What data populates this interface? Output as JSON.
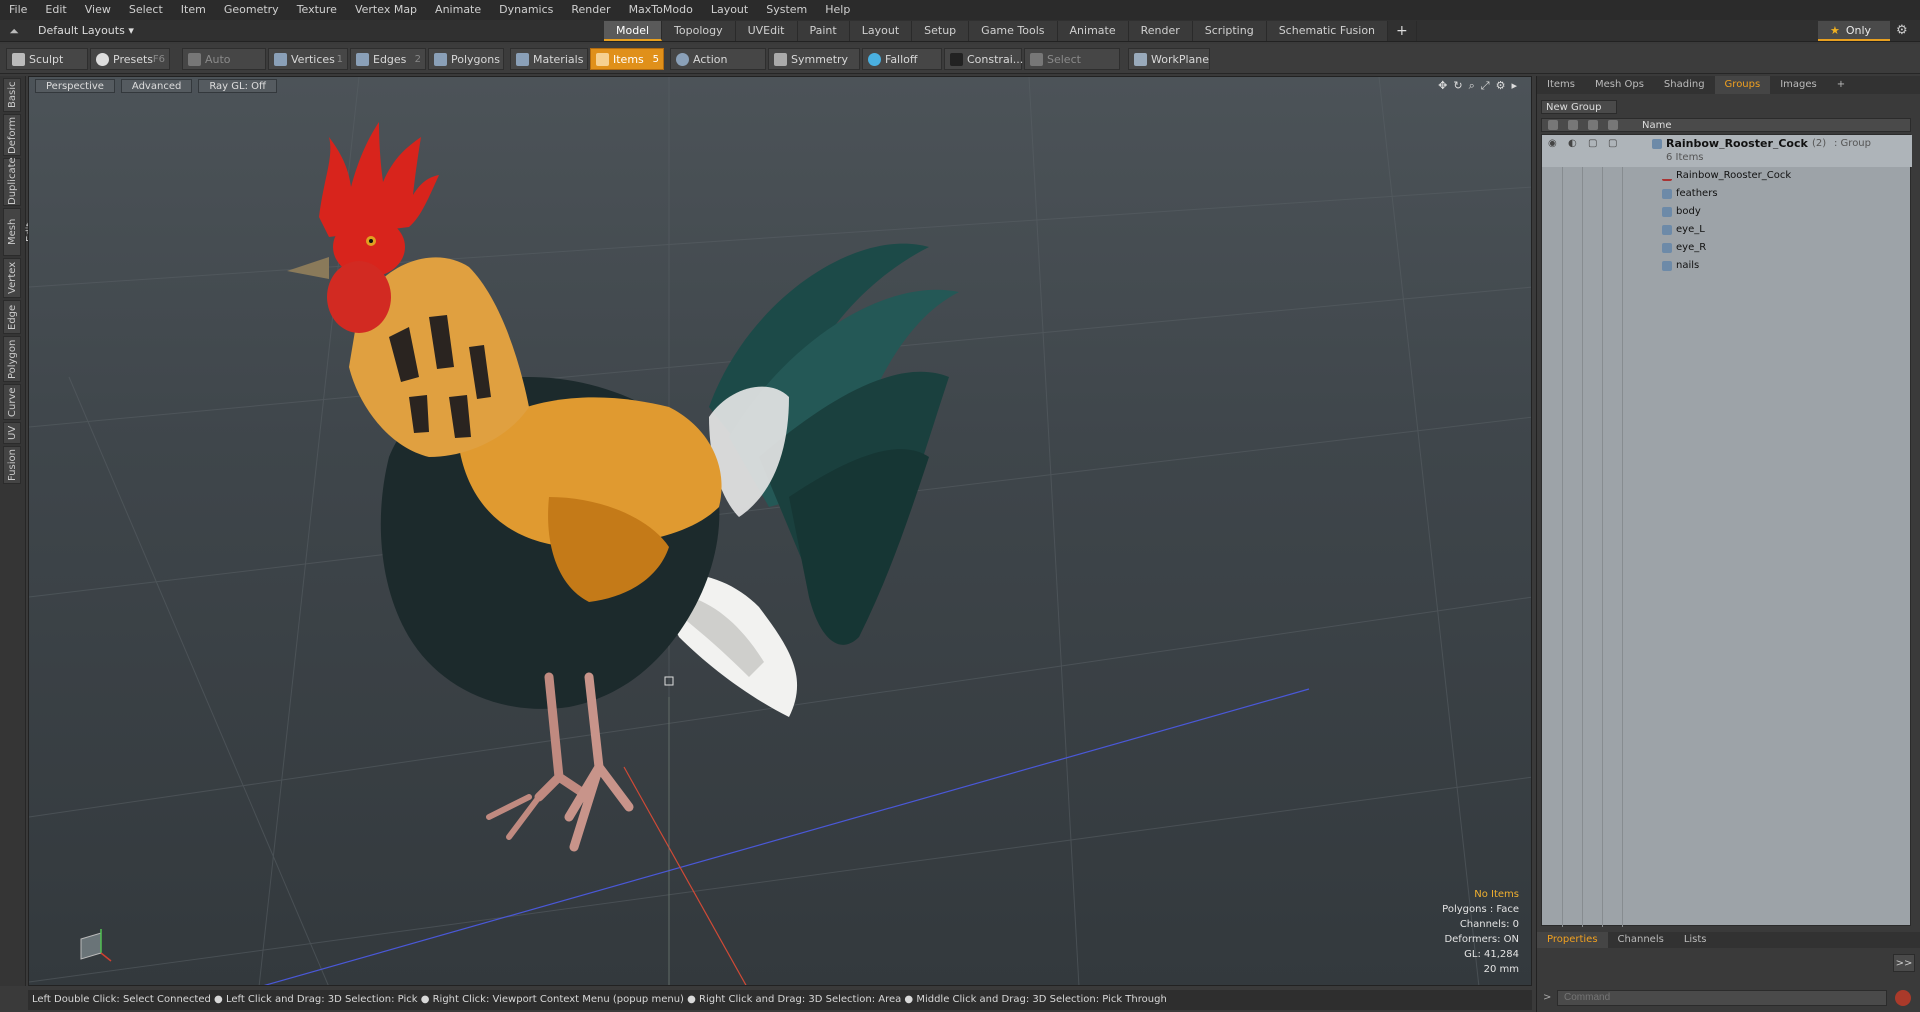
{
  "menu": [
    "File",
    "Edit",
    "View",
    "Select",
    "Item",
    "Geometry",
    "Texture",
    "Vertex Map",
    "Animate",
    "Dynamics",
    "Render",
    "MaxToModo",
    "Layout",
    "System",
    "Help"
  ],
  "layout_label": "Default Layouts",
  "tabs": [
    "Model",
    "Topology",
    "UVEdit",
    "Paint",
    "Layout",
    "Setup",
    "Game Tools",
    "Animate",
    "Render",
    "Scripting",
    "Schematic Fusion"
  ],
  "active_tab": "Model",
  "only_label": "Only",
  "toolbar": {
    "sculpt": "Sculpt",
    "presets": "Presets",
    "presets_key": "F6",
    "auto_select": "Auto Select",
    "vertices": "Vertices",
    "vertices_count": "1",
    "edges": "Edges",
    "edges_count": "2",
    "polygons": "Polygons",
    "materials": "Materials",
    "items": "Items",
    "items_count": "5",
    "action_center": "Action Center",
    "symmetry": "Symmetry",
    "falloff": "Falloff",
    "constrain": "Constrai...",
    "select_through": "Select Through",
    "workplane": "WorkPlane"
  },
  "left_tabs": [
    "Basic",
    "Deform",
    "Duplicate",
    "Mesh Edit",
    "Vertex",
    "Edge",
    "Polygon",
    "Curve",
    "UV",
    "Fusion"
  ],
  "viewport": {
    "perspective": "Perspective",
    "advanced": "Advanced",
    "raygl": "Ray GL: Off",
    "info": {
      "items": "No Items",
      "polygons": "Polygons : Face",
      "channels": "Channels: 0",
      "deformers": "Deformers: ON",
      "gl": "GL: 41,284",
      "size": "20 mm"
    }
  },
  "status_text": "Left Double Click: Select Connected ● Left Click and Drag: 3D Selection: Pick ● Right Click: Viewport Context Menu (popup menu) ● Right Click and Drag: 3D Selection: Area ● Middle Click and Drag: 3D Selection: Pick Through",
  "right_panel": {
    "tabs": [
      "Items",
      "Mesh Ops",
      "Shading",
      "Groups",
      "Images"
    ],
    "active_tab": "Groups",
    "new_group": "New Group",
    "name_header": "Name",
    "group_name": "Rainbow_Rooster_Cock",
    "group_count": "(2)",
    "group_type": ": Group",
    "group_items": "6 Items",
    "children": [
      "Rainbow_Rooster_Cock",
      "feathers",
      "body",
      "eye_L",
      "eye_R",
      "nails"
    ]
  },
  "bottom_panel": {
    "tabs": [
      "Properties",
      "Channels",
      "Lists"
    ],
    "active_tab": "Properties",
    "command_placeholder": "Command"
  },
  "colors": {
    "accent": "#e0901a",
    "rooster_comb": "#d8241c",
    "rooster_neck": "#e09a30",
    "rooster_body": "#1c2a2c",
    "rooster_tail": "#1c4a48",
    "axis_x": "#d04030",
    "axis_z": "#4050d0"
  }
}
